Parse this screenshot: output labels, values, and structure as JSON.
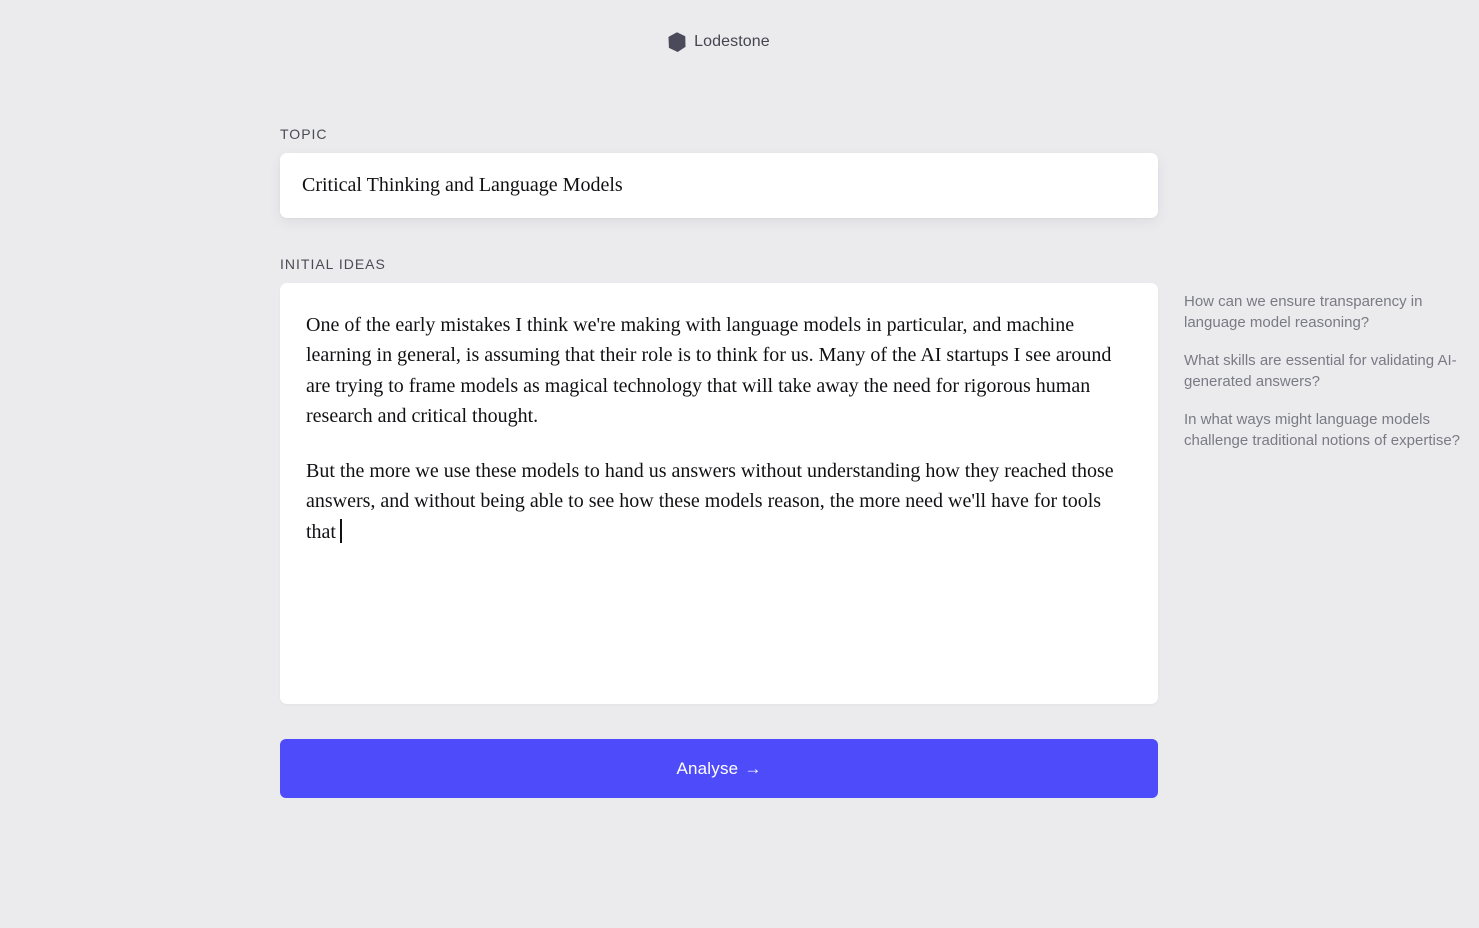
{
  "brand": {
    "name": "Lodestone",
    "logo_icon": "hexagon-logo-icon",
    "logo_color": "#4a4a5a"
  },
  "topic": {
    "label": "TOPIC",
    "value": "Critical Thinking and Language Models"
  },
  "ideas": {
    "label": "INITIAL IDEAS",
    "paragraphs": [
      "One of the early mistakes I think we're making with language models in particular, and machine learning in general, is assuming that their role is to think for us. Many of the AI startups I see around are trying to frame models as magical technology that will take away the need for rigorous human research and critical thought.",
      "But the more we use these models to hand us answers without understanding how they reached those answers, and without being able to see how these models reason, the more need we'll have for tools that"
    ]
  },
  "analyse_button": {
    "label": "Analyse",
    "arrow": "→",
    "color": "#4e4bfa"
  },
  "suggestions": [
    "How can we ensure transparency in language model reasoning?",
    "What skills are essential for validating AI-generated answers?",
    "In what ways might language models challenge traditional notions of expertise?"
  ],
  "colors": {
    "background": "#ebebee",
    "accent": "#4e4bfa"
  }
}
